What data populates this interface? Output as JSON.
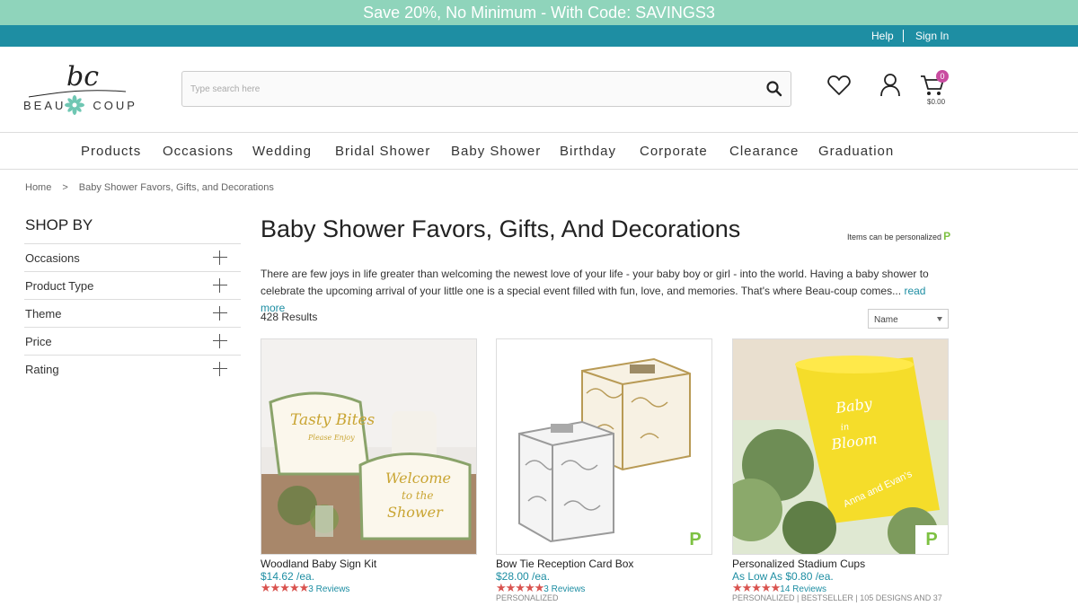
{
  "promo": {
    "text": "Save 20%, No Minimum - With Code: SAVINGS3"
  },
  "utility": {
    "help": "Help",
    "signin": "Sign In"
  },
  "logo": {
    "script": "bc",
    "word_left": "BEAU",
    "word_right": "COUP"
  },
  "search": {
    "placeholder": "Type search here"
  },
  "cart": {
    "count": "0",
    "amount": "$0.00"
  },
  "nav": [
    "Products",
    "Occasions",
    "Wedding",
    "Bridal Shower",
    "Baby Shower",
    "Birthday",
    "Corporate",
    "Clearance",
    "Graduation"
  ],
  "breadcrumb": {
    "home": "Home",
    "arrow": ">",
    "current": "Baby Shower Favors, Gifts, and Decorations"
  },
  "sidebar": {
    "title": "SHOP BY",
    "filters": [
      "Occasions",
      "Product Type",
      "Theme",
      "Price",
      "Rating"
    ]
  },
  "main": {
    "title": "Baby Shower Favors, Gifts, And Decorations",
    "personal_note": "Items can be personalized",
    "personal_badge": "P",
    "intro": "There are few joys in life greater than welcoming the newest love of your life - your baby boy or girl - into the world. Having a baby shower to celebrate the upcoming arrival of your little one is a special event filled with fun, love, and memories. That's where Beau-coup comes...",
    "read_more": "read more",
    "results": "428 Results",
    "sort": "Name"
  },
  "products": [
    {
      "name": "Woodland Baby Sign Kit",
      "price": "$14.62 /ea.",
      "stars": "★★★★★",
      "reviews": "3 Reviews",
      "tags": "",
      "personalized": false
    },
    {
      "name": "Bow Tie Reception Card Box",
      "price": "$28.00 /ea.",
      "stars": "★★★★★",
      "reviews": "3 Reviews",
      "tags": "PERSONALIZED",
      "badge": "P",
      "personalized": true
    },
    {
      "name": "Personalized Stadium Cups",
      "price": "As Low As $0.80 /ea.",
      "stars": "★★★★★",
      "reviews": "14 Reviews",
      "tags": "PERSONALIZED | BESTSELLER | 105 DESIGNS AND 37",
      "badge": "P",
      "personalized": true
    }
  ],
  "colors": {
    "promo": "#8fd4bb",
    "utility": "#1e8ea3",
    "link": "#1e8ea3",
    "stars": "#d9534f",
    "badge": "#c94ca0",
    "personalize": "#7dc142"
  }
}
